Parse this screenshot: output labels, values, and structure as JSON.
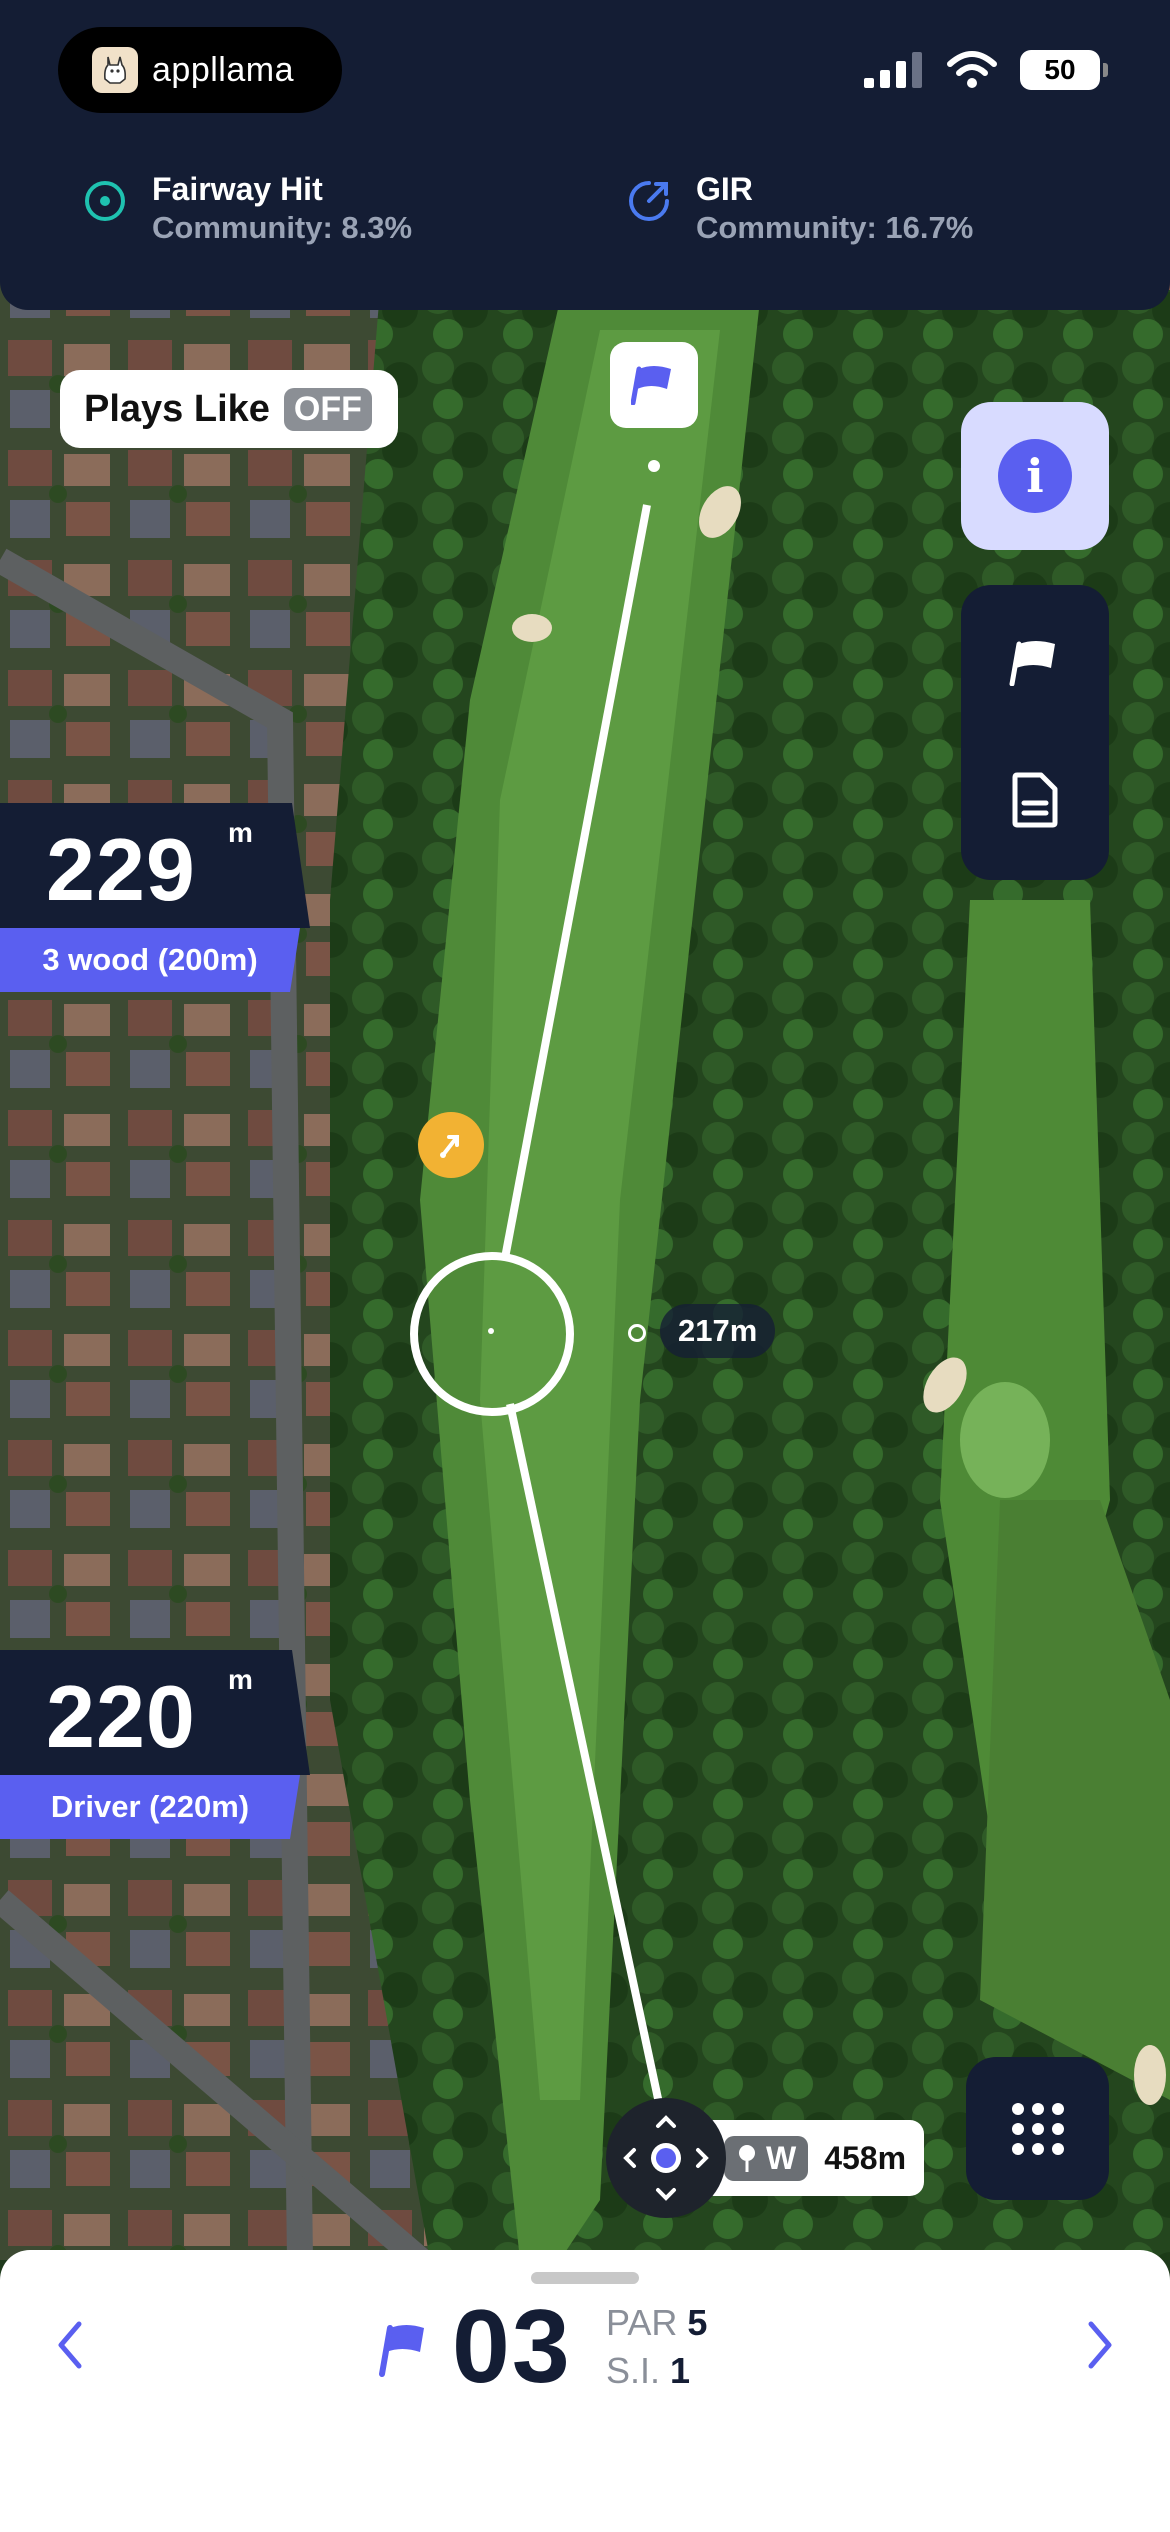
{
  "app": {
    "brand": "appllama"
  },
  "status_bar": {
    "battery": "50"
  },
  "stats": [
    {
      "title": "Fairway Hit",
      "subtitle": "Community: 8.3%",
      "icon": "target-icon"
    },
    {
      "title": "GIR",
      "subtitle": "Community: 16.7%",
      "icon": "gauge-icon"
    }
  ],
  "plays_like": {
    "label": "Plays Like",
    "state": "OFF"
  },
  "distances": [
    {
      "value": "229",
      "unit": "m",
      "club": "3 wood (200m)"
    },
    {
      "value": "220",
      "unit": "m",
      "club": "Driver (220m)"
    }
  ],
  "target_distance": "217m",
  "tee": {
    "wind": "W",
    "distance": "458m"
  },
  "hole": {
    "number": "03",
    "par_label": "PAR",
    "par": "5",
    "si_label": "S.I.",
    "si": "1"
  },
  "colors": {
    "navy": "#141d34",
    "accent": "#5a5ff0",
    "accent_light": "#d8dbff",
    "hazard": "#f2b233"
  }
}
